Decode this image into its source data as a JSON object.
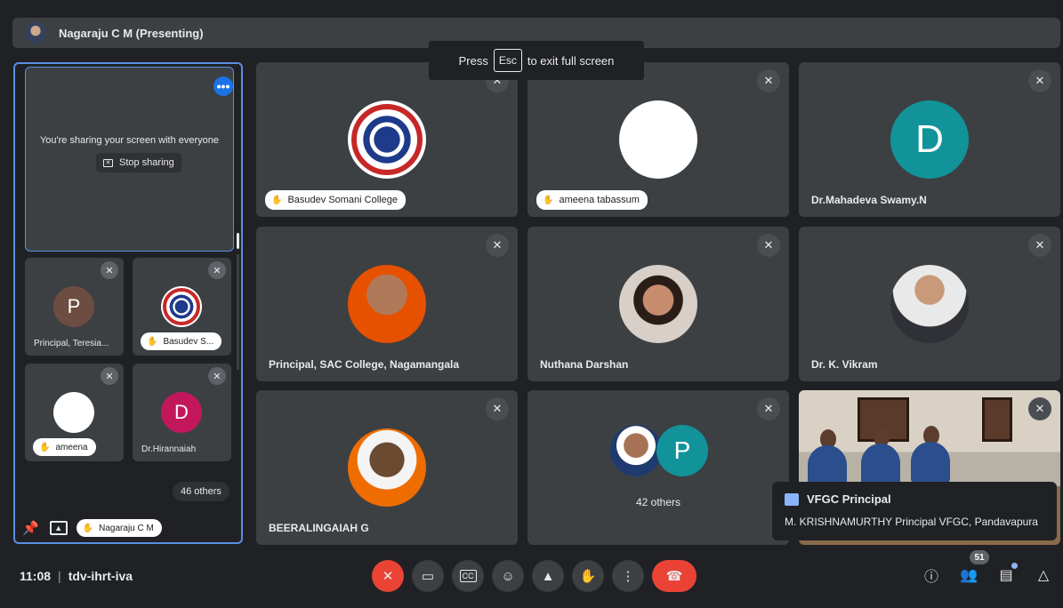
{
  "presenter_bar": {
    "name": "Nagaraju C M (Presenting)"
  },
  "fullscreen_toast": {
    "press": "Press",
    "key": "Esc",
    "rest": "to exit full screen"
  },
  "share_panel": {
    "message": "You're sharing your screen with everyone",
    "stop_label": "Stop sharing",
    "more_icon": "more-horiz-icon"
  },
  "mini_tiles": [
    {
      "name": "Principal, Teresia...",
      "initial": "P",
      "color": "#6d4c41"
    },
    {
      "name": "Basudev S..."
    },
    {
      "name": "ameena"
    },
    {
      "name": "Dr.Hirannaiah",
      "initial": "D",
      "color": "#c2185b"
    }
  ],
  "others_pill": "46 others",
  "self": {
    "name": "Nagaraju C M"
  },
  "tiles": [
    {
      "name": "Basudev Somani College"
    },
    {
      "name": "ameena tabassum"
    },
    {
      "name": "Dr.Mahadeva Swamy.N",
      "initial": "D",
      "color": "#12939a"
    },
    {
      "name": "Principal, SAC College, Nagamangala"
    },
    {
      "name": "Nuthana Darshan"
    },
    {
      "name": "Dr. K. Vikram"
    },
    {
      "name": "BEERALINGAIAH G"
    },
    {
      "name": "42 others",
      "initial": "P",
      "color": "#12939a"
    }
  ],
  "caption": {
    "speaker": "VFGC Principal",
    "text": "M. KRISHNAMURTHY Principal VFGC, Pandavapura"
  },
  "bottom": {
    "time": "11:08",
    "separator": "|",
    "meeting_code": "tdv-ihrt-iva",
    "people_count": "51"
  },
  "colors": {
    "accent": "#1a73e8",
    "danger": "#ea4335",
    "tile": "#3c4043",
    "bg": "#202124"
  }
}
